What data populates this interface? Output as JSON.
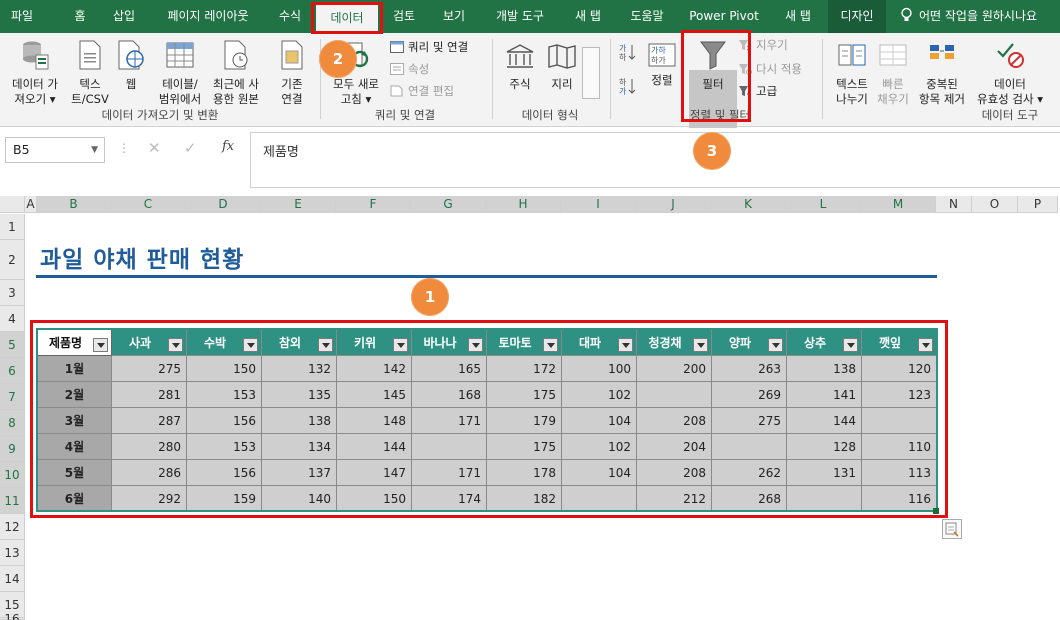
{
  "tabs": [
    {
      "label": "파일"
    },
    {
      "label": "홈"
    },
    {
      "label": "삽입"
    },
    {
      "label": "페이지 레이아웃"
    },
    {
      "label": "수식"
    },
    {
      "label": "데이터"
    },
    {
      "label": "검토"
    },
    {
      "label": "보기"
    },
    {
      "label": "개발 도구"
    },
    {
      "label": "새 탭"
    },
    {
      "label": "도움말"
    },
    {
      "label": "Power Pivot"
    },
    {
      "label": "새 탭"
    },
    {
      "label": "디자인"
    }
  ],
  "tell_me": "어떤 작업을 원하시나요",
  "ribbon": {
    "get_data": {
      "line1": "데이터 가",
      "line2": "져오기"
    },
    "text_csv": {
      "line1": "텍스",
      "line2": "트/CSV"
    },
    "web": {
      "line1": "웹"
    },
    "from_table": {
      "line1": "테이블/",
      "line2": "범위에서"
    },
    "recent_sources": {
      "line1": "최근에 사",
      "line2": "용한 원본"
    },
    "existing_conn": {
      "line1": "기존",
      "line2": "연결"
    },
    "group_get_transform": "데이터 가져오기 및 변환",
    "refresh_all": {
      "line1": "모두 새로",
      "line2": "고침"
    },
    "queries_conn": "쿼리 및 연결",
    "properties": "속성",
    "edit_links": "연결 편집",
    "group_queries": "쿼리 및 연결",
    "stocks": "주식",
    "geography": "지리",
    "group_datatypes": "데이터 형식",
    "sort": "정렬",
    "filter": "필터",
    "clear": "지우기",
    "reapply": "다시 적용",
    "advanced": "고급",
    "group_sort_filter": "정렬 및 필터",
    "text_to_columns": {
      "line1": "텍스트",
      "line2": "나누기"
    },
    "flash_fill": {
      "line1": "빠른",
      "line2": "채우기"
    },
    "remove_dup": {
      "line1": "중복된",
      "line2": "항목 제거"
    },
    "validation": {
      "line1": "데이터",
      "line2": "유효성 검사"
    },
    "group_datatools": "데이터 도구"
  },
  "callouts": [
    "1",
    "2",
    "3"
  ],
  "namebox": "B5",
  "formula_icon": "fx",
  "formula_value": "제품명",
  "columns": [
    "A",
    "B",
    "C",
    "D",
    "E",
    "F",
    "G",
    "H",
    "I",
    "J",
    "K",
    "L",
    "M",
    "N",
    "O",
    "P"
  ],
  "rows": [
    "1",
    "2",
    "3",
    "4",
    "5",
    "6",
    "7",
    "8",
    "9",
    "10",
    "11",
    "12",
    "13",
    "14",
    "15",
    "16"
  ],
  "sheet_title": "과일 야채 판매 현황",
  "table": {
    "headers": [
      "제품명",
      "사과",
      "수박",
      "참외",
      "키위",
      "바나나",
      "토마토",
      "대파",
      "청경채",
      "양파",
      "상추",
      "깻잎"
    ],
    "rows": [
      [
        "1월",
        "275",
        "150",
        "132",
        "142",
        "165",
        "172",
        "100",
        "200",
        "263",
        "138",
        "120"
      ],
      [
        "2월",
        "281",
        "153",
        "135",
        "145",
        "168",
        "175",
        "102",
        "",
        "269",
        "141",
        "123"
      ],
      [
        "3월",
        "287",
        "156",
        "138",
        "148",
        "171",
        "179",
        "104",
        "208",
        "275",
        "144",
        ""
      ],
      [
        "4월",
        "280",
        "153",
        "134",
        "144",
        "",
        "175",
        "102",
        "204",
        "",
        "128",
        "110"
      ],
      [
        "5월",
        "286",
        "156",
        "137",
        "147",
        "171",
        "178",
        "104",
        "208",
        "262",
        "131",
        "113"
      ],
      [
        "6월",
        "292",
        "159",
        "140",
        "150",
        "174",
        "182",
        "",
        "212",
        "268",
        "",
        "116"
      ]
    ]
  },
  "colors": {
    "excel_green": "#217346",
    "table_header": "#2e9184",
    "title_blue": "#1f5c99",
    "highlight_red": "#e01010",
    "callout_orange": "#f08a3c"
  }
}
